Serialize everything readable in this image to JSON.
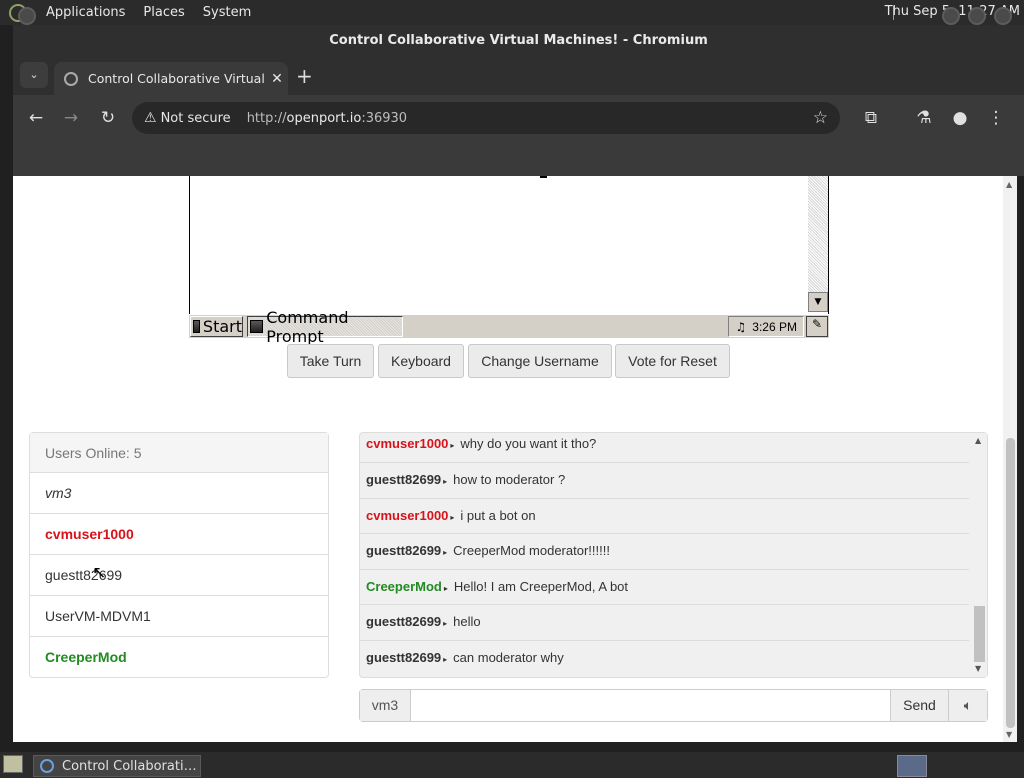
{
  "panel": {
    "menus": [
      "Applications",
      "Places",
      "System"
    ],
    "clock": "Thu Sep  5, 11:27 AM"
  },
  "window": {
    "title": "Control Collaborative Virtual Machines! - Chromium"
  },
  "browser": {
    "tab_title": "Control Collaborative Virtual Machines!",
    "security_label": "Not secure",
    "url_prefix": "http://",
    "url_host": "openport.io",
    "url_port": ":36930"
  },
  "vm": {
    "start_label": "Start",
    "task_label": "Command Prompt",
    "tray_time": "3:26 PM"
  },
  "actions": {
    "take_turn": "Take Turn",
    "keyboard": "Keyboard",
    "change_username": "Change Username",
    "vote_reset": "Vote for Reset"
  },
  "users": {
    "header": "Users Online: 5",
    "list": [
      {
        "name": "vm3",
        "color": "#333333"
      },
      {
        "name": "cvmuser1000",
        "color": "#d9121a"
      },
      {
        "name": "guestt82699",
        "color": "#333333"
      },
      {
        "name": "UserVM-MDVM1",
        "color": "#333333"
      },
      {
        "name": "CreeperMod",
        "color": "#228b22"
      }
    ]
  },
  "chat": {
    "messages": [
      {
        "user": "cvmuser1000",
        "text": "why do you want it tho?",
        "color": "#d9121a"
      },
      {
        "user": "guestt82699",
        "text": "how to moderator ?",
        "color": "#222222"
      },
      {
        "user": "cvmuser1000",
        "text": "i put a bot on",
        "color": "#d9121a"
      },
      {
        "user": "guestt82699",
        "text": "CreeperMod moderator!!!!!!",
        "color": "#222222"
      },
      {
        "user": "CreeperMod",
        "text": "Hello! I am CreeperMod, A bot",
        "color": "#228b22"
      },
      {
        "user": "guestt82699",
        "text": "hello",
        "color": "#222222"
      },
      {
        "user": "guestt82699",
        "text": "can moderator why",
        "color": "#222222"
      }
    ],
    "username_addon": "vm3",
    "input_value": "",
    "send_label": "Send"
  },
  "taskbar": {
    "task_label": "Control Collaborati…"
  }
}
